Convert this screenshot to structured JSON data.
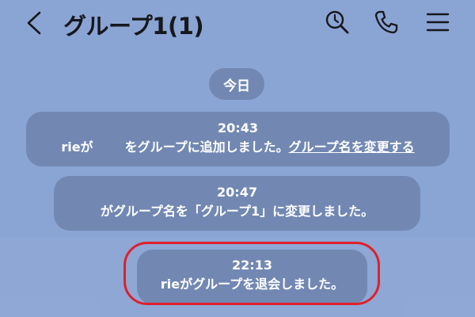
{
  "header": {
    "back_icon": "chevron-left-icon",
    "title": "グループ1(1)",
    "search_icon": "search-icon",
    "call_icon": "phone-icon",
    "menu_icon": "hamburger-menu-icon"
  },
  "date_separator": "今日",
  "messages": [
    {
      "time": "20:43",
      "text_before": "rieが",
      "text_after": "をグループに追加しました。",
      "link": "グループ名を変更する"
    },
    {
      "time": "20:47",
      "text": "がグループ名を「グループ1」に変更しました。"
    },
    {
      "time": "22:13",
      "text": "rieがグループを退会しました。"
    }
  ],
  "colors": {
    "background": "#8aa4d4",
    "bubble": "#7288b3",
    "highlight": "#e0202a"
  }
}
